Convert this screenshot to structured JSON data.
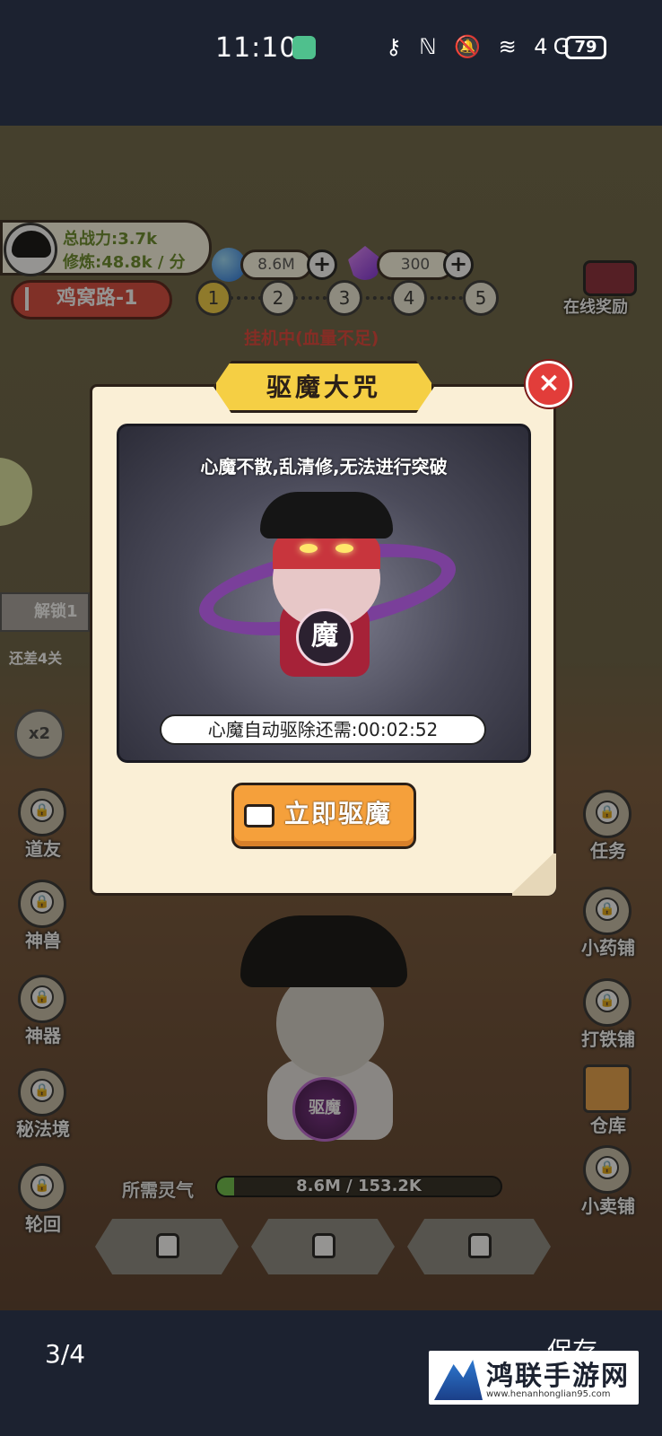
{
  "status_bar": {
    "time": "11:10",
    "icons": "⚷ ℕ 🔕 ≋ 4G",
    "battery": "79"
  },
  "hud": {
    "power": "总战力:3.7k",
    "speed": "修炼:48.8k / 分",
    "spirit_stones": "8.6M",
    "gems": "300",
    "stage": "鸡窝路-1",
    "stage_nodes": [
      "1",
      "2",
      "3",
      "4",
      "5"
    ],
    "idle_status": "挂机中(血量不足)",
    "online_reward": "在线奖励",
    "unlock": "解锁1",
    "warning": "还差4关",
    "speed_multiplier": "x2"
  },
  "left_menu": [
    "道友",
    "神兽",
    "神器",
    "秘法境",
    "轮回"
  ],
  "right_menu": [
    "任务",
    "小药铺",
    "打铁铺",
    "仓库",
    "小卖铺"
  ],
  "exorcise_orb": "驱魔",
  "qi": {
    "label": "所需灵气",
    "value": "8.6M / 153.2K",
    "fill_fraction": 0.06
  },
  "modal": {
    "title": "驱魔大咒",
    "caption": "心魔不散,乱清修,无法进行突破",
    "seal": "魔",
    "timer": "心魔自动驱除还需:00:02:52",
    "action": "立即驱魔",
    "close": "×"
  },
  "bottom": {
    "page_counter": "3/4",
    "save": "保存"
  },
  "watermark": {
    "title": "鸿联手游网",
    "url": "www.henanhonglian95.com"
  }
}
